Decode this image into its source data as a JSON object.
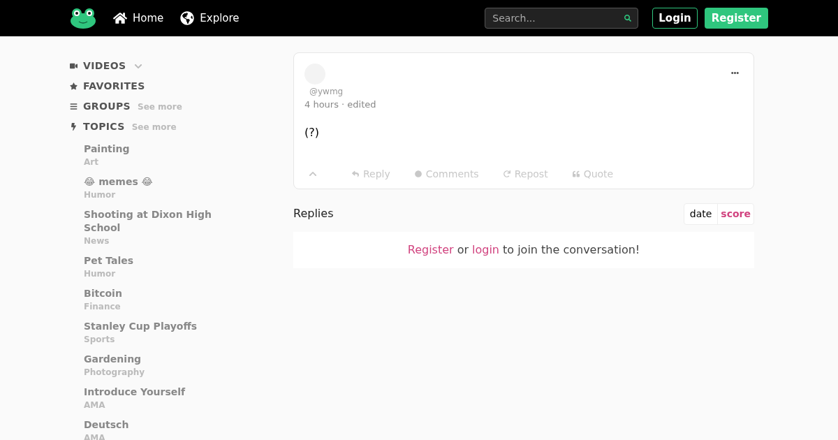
{
  "header": {
    "nav": [
      {
        "kind": "home",
        "label": "Home"
      },
      {
        "kind": "explore",
        "label": "Explore"
      }
    ],
    "search": {
      "placeholder": "Search..."
    },
    "login": "Login",
    "register": "Register"
  },
  "sidebar": {
    "sections": [
      {
        "kind": "video",
        "label": "VIDEOS",
        "expandable": true
      },
      {
        "kind": "star",
        "label": "FAVORITES"
      },
      {
        "kind": "list",
        "label": "GROUPS",
        "link": "See more"
      },
      {
        "kind": "bolt",
        "label": "TOPICS",
        "link": "See more"
      }
    ],
    "topics": [
      {
        "name": "Painting",
        "category": "Art"
      },
      {
        "name": "😂 memes 😂",
        "category": "Humor"
      },
      {
        "name": "Shooting at Dixon High School",
        "category": "News"
      },
      {
        "name": "Pet Tales",
        "category": "Humor"
      },
      {
        "name": "Bitcoin",
        "category": "Finance"
      },
      {
        "name": "Stanley Cup Playoffs",
        "category": "Sports"
      },
      {
        "name": "Gardening",
        "category": "Photography"
      },
      {
        "name": "Introduce Yourself",
        "category": "AMA"
      },
      {
        "name": "Deutsch",
        "category": "AMA"
      }
    ]
  },
  "post": {
    "handle": "@ywmg",
    "meta": "4 hours · edited",
    "body": "(?)",
    "actions": [
      {
        "kind": "reply",
        "label": "Reply"
      },
      {
        "kind": "comments",
        "label": "Comments"
      },
      {
        "kind": "repost",
        "label": "Repost"
      },
      {
        "kind": "quote",
        "label": "Quote"
      }
    ]
  },
  "replies": {
    "title": "Replies",
    "sort": [
      {
        "label": "date",
        "selected": false
      },
      {
        "label": "score",
        "selected": true
      }
    ],
    "prompt": {
      "register": "Register",
      "middle": "or",
      "login": "login",
      "end": "to join the conversation!"
    }
  }
}
